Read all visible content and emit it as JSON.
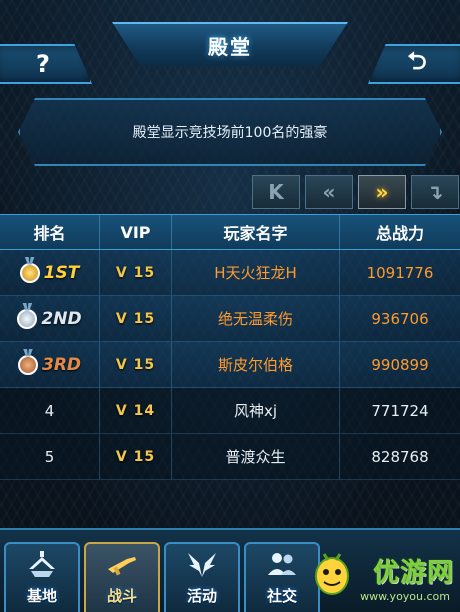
{
  "header": {
    "title": "殿堂",
    "help_label": "?",
    "back_label": "⮌"
  },
  "banner": {
    "text": "殿堂显示竞技场前100名的强豪"
  },
  "pager": {
    "first_label": "K",
    "prev_label": "«",
    "next_label": "»",
    "last_label": "↴"
  },
  "table": {
    "headers": {
      "rank": "排名",
      "vip": "VIP",
      "name": "玩家名字",
      "power": "总战力"
    },
    "rows": [
      {
        "rank": "1ST",
        "medal": "gold",
        "vip": "V 15",
        "name": "H天火狂龙H",
        "power": "1091776"
      },
      {
        "rank": "2ND",
        "medal": "silver",
        "vip": "V 15",
        "name": "绝无温柔伤",
        "power": "936706"
      },
      {
        "rank": "3RD",
        "medal": "bronze",
        "vip": "V 15",
        "name": "斯皮尔伯格",
        "power": "990899"
      },
      {
        "rank": "4",
        "vip": "V 14",
        "name": "风神xj",
        "power": "771724"
      },
      {
        "rank": "5",
        "vip": "V 15",
        "name": "普渡众生",
        "power": "828768"
      }
    ]
  },
  "nav": {
    "items": [
      {
        "label": "基地",
        "icon": "base-icon"
      },
      {
        "label": "战斗",
        "icon": "weapon-icon",
        "active": true
      },
      {
        "label": "活动",
        "icon": "wings-icon"
      },
      {
        "label": "社交",
        "icon": "people-icon"
      }
    ]
  },
  "watermark": {
    "text": "优游网",
    "url": "www.yoyou.com"
  },
  "colors": {
    "accent": "#3fa2de",
    "gold_text": "#ff9a2e",
    "vip": "#f4c64c"
  }
}
